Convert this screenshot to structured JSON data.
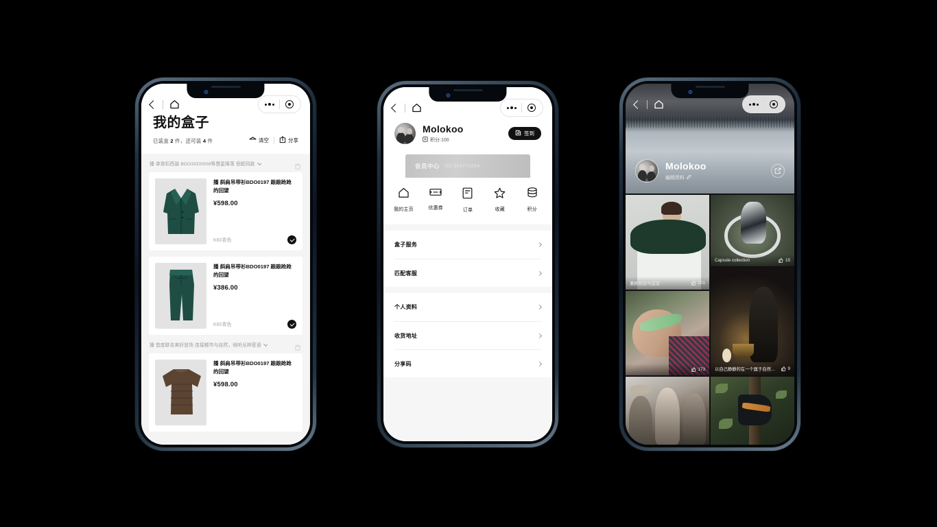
{
  "scene": {
    "background": "#000000",
    "device_count": 3
  },
  "phone1": {
    "nav": {
      "back_icon": "chevron-left-icon",
      "home_icon": "home-icon",
      "more_icon": "more-dots-icon",
      "target_icon": "target-circle-icon"
    },
    "title": "我的盒子",
    "subtitle_prefix": "已装盒",
    "packed_count": "2",
    "subtitle_mid": "件，还可装",
    "remaining_count": "4",
    "subtitle_suffix": "件",
    "actions": [
      {
        "label": "清空",
        "icon": "box-empty-icon"
      },
      {
        "label": "分享",
        "icon": "share-icon"
      }
    ],
    "sections": [
      {
        "header": "播 单排扣西装 BDO3XD0008等慧星降落 倪妮同款",
        "delete_icon": "trash-icon",
        "items": [
          {
            "name": "播 斜肩吊带衫BDO0197 踉踉跄跄的回望",
            "price": "¥598.00",
            "sku": "K60青色",
            "selected": true,
            "art": "blazer"
          },
          {
            "name": "播 斜肩吊带衫BDO0197 踉踉跄跄的回望",
            "price": "¥386.00",
            "sku": "K60青色",
            "selected": true,
            "art": "pants"
          }
        ]
      },
      {
        "header": "播 首度联名美好登场 连接都市与自然，倾听丛林密语",
        "delete_icon": "trash-icon",
        "items": [
          {
            "name": "播 斜肩吊带衫BDO0197 踉踉跄跄的回望",
            "price": "¥598.00",
            "sku": "",
            "selected": false,
            "art": "sweater"
          }
        ]
      }
    ]
  },
  "phone2": {
    "nav": {
      "back_icon": "chevron-left-icon",
      "home_icon": "home-icon",
      "more_icon": "more-dots-icon",
      "target_icon": "target-circle-icon"
    },
    "user": {
      "name": "Molokoo",
      "points_label": "积分:100",
      "points_icon": "coin-icon"
    },
    "signin": {
      "label": "签到",
      "icon": "edit-square-icon"
    },
    "member_card": {
      "title": "会员中心",
      "number": "NO.38477326A"
    },
    "nav_items": [
      {
        "label": "我的主页",
        "icon": "home-icon"
      },
      {
        "label": "优惠券",
        "icon": "ticket-icon"
      },
      {
        "label": "订单",
        "icon": "order-list-icon"
      },
      {
        "label": "收藏",
        "icon": "star-icon"
      },
      {
        "label": "积分",
        "icon": "coins-stack-icon"
      }
    ],
    "menu_groups": [
      {
        "rows": [
          {
            "label": "盒子服务",
            "chevron": "chevron-right-icon"
          },
          {
            "label": "匹配客服",
            "chevron": "chevron-right-icon"
          }
        ]
      },
      {
        "rows": [
          {
            "label": "个人资料",
            "chevron": "chevron-right-icon"
          },
          {
            "label": "收货地址",
            "chevron": "chevron-right-icon"
          },
          {
            "label": "分享码",
            "chevron": "chevron-right-icon"
          }
        ]
      }
    ]
  },
  "phone3": {
    "nav": {
      "back_icon": "chevron-left-icon",
      "home_icon": "home-icon",
      "more_icon": "more-dots-icon",
      "target_icon": "target-circle-icon"
    },
    "user": {
      "name": "Molokoo",
      "edit_label": "编辑资料",
      "edit_icon": "pencil-icon",
      "share_icon": "share-box-icon"
    },
    "feed_left": [
      {
        "caption": "兼顾舒适与造型",
        "likes": "201",
        "like_icon": "thumbs-up-icon",
        "art": "art1"
      },
      {
        "caption": "",
        "likes": "173",
        "like_icon": "thumbs-up-icon",
        "art": "art3"
      },
      {
        "caption": "",
        "likes": "",
        "like_icon": "thumbs-up-icon",
        "art": "art5"
      }
    ],
    "feed_right": [
      {
        "caption": "Capsule collection",
        "likes": "15",
        "like_icon": "thumbs-up-icon",
        "art": "art2"
      },
      {
        "caption": "以自己静静的在一个属于自然…",
        "likes": "9",
        "like_icon": "thumbs-up-icon",
        "art": "art4"
      },
      {
        "caption": "",
        "likes": "",
        "like_icon": "thumbs-up-icon",
        "art": "art6"
      }
    ]
  }
}
